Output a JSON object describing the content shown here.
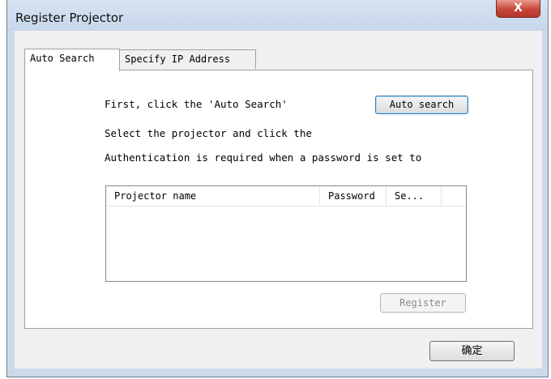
{
  "window": {
    "title": "Register Projector",
    "close_label": "X"
  },
  "tabs": [
    {
      "label": "Auto Search",
      "active": true
    },
    {
      "label": "Specify IP Address",
      "active": false
    }
  ],
  "panel": {
    "instruction_1": "First, click the 'Auto Search'",
    "auto_search_label": "Auto search",
    "instruction_2": "Select the projector and click the",
    "instruction_3": "Authentication is required when a password is set to",
    "list_columns": [
      "Projector name",
      "Password",
      "Se..."
    ],
    "register_label": "Register"
  },
  "footer": {
    "ok_label": "确定"
  }
}
